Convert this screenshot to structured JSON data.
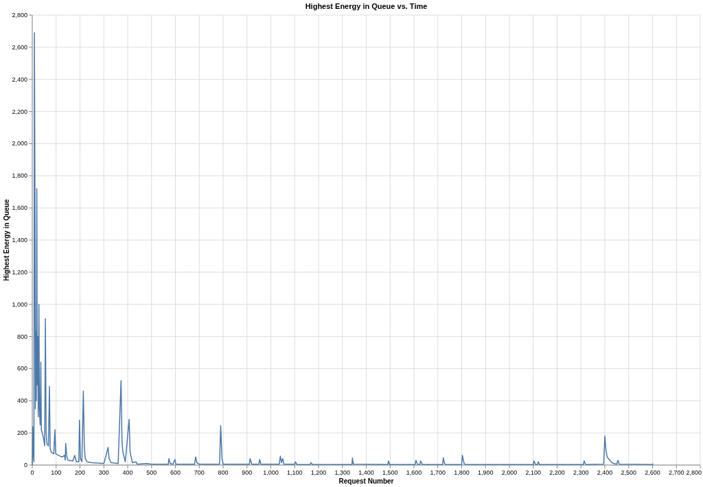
{
  "chart_data": {
    "type": "line",
    "title": "Highest Energy in Queue vs. Time",
    "xlabel": "Request Number",
    "ylabel": "Highest Energy in Queue",
    "xlim": [
      0,
      2800
    ],
    "ylim": [
      0,
      2800
    ],
    "xticks": [
      {
        "value": 0,
        "label": "0"
      },
      {
        "value": 100,
        "label": "100"
      },
      {
        "value": 200,
        "label": "200"
      },
      {
        "value": 300,
        "label": "300"
      },
      {
        "value": 400,
        "label": "400"
      },
      {
        "value": 500,
        "label": "500"
      },
      {
        "value": 600,
        "label": "600"
      },
      {
        "value": 700,
        "label": "700"
      },
      {
        "value": 800,
        "label": "800"
      },
      {
        "value": 900,
        "label": "900"
      },
      {
        "value": 1000,
        "label": "1,000"
      },
      {
        "value": 1100,
        "label": "1,100"
      },
      {
        "value": 1200,
        "label": "1,200"
      },
      {
        "value": 1300,
        "label": "1,300"
      },
      {
        "value": 1400,
        "label": "1,400"
      },
      {
        "value": 1500,
        "label": "1,500"
      },
      {
        "value": 1600,
        "label": "1,600"
      },
      {
        "value": 1700,
        "label": "1,700"
      },
      {
        "value": 1800,
        "label": "1,800"
      },
      {
        "value": 1900,
        "label": "1,900"
      },
      {
        "value": 2000,
        "label": "2,000"
      },
      {
        "value": 2100,
        "label": "2,100"
      },
      {
        "value": 2200,
        "label": "2,200"
      },
      {
        "value": 2300,
        "label": "2,300"
      },
      {
        "value": 2400,
        "label": "2,400"
      },
      {
        "value": 2500,
        "label": "2,500"
      },
      {
        "value": 2600,
        "label": "2,600"
      },
      {
        "value": 2700,
        "label": "2,700"
      },
      {
        "value": 2800,
        "label": "2,800"
      }
    ],
    "yticks": [
      {
        "value": 0,
        "label": "0"
      },
      {
        "value": 200,
        "label": "200"
      },
      {
        "value": 400,
        "label": "400"
      },
      {
        "value": 600,
        "label": "600"
      },
      {
        "value": 800,
        "label": "800"
      },
      {
        "value": 1000,
        "label": "1,000"
      },
      {
        "value": 1200,
        "label": "1,200"
      },
      {
        "value": 1400,
        "label": "1,400"
      },
      {
        "value": 1600,
        "label": "1,600"
      },
      {
        "value": 1800,
        "label": "1,800"
      },
      {
        "value": 2000,
        "label": "2,000"
      },
      {
        "value": 2200,
        "label": "2,200"
      },
      {
        "value": 2400,
        "label": "2,400"
      },
      {
        "value": 2600,
        "label": "2,600"
      },
      {
        "value": 2800,
        "label": "2,800"
      }
    ],
    "x": [
      0,
      2,
      5,
      7,
      9,
      11,
      13,
      15,
      17,
      19,
      21,
      23,
      25,
      28,
      30,
      33,
      36,
      38,
      42,
      48,
      52,
      55,
      58,
      62,
      68,
      72,
      75,
      80,
      90,
      95,
      98,
      110,
      125,
      135,
      138,
      140,
      145,
      150,
      170,
      178,
      185,
      195,
      198,
      202,
      208,
      214,
      218,
      222,
      230,
      250,
      300,
      318,
      322,
      330,
      360,
      372,
      376,
      380,
      390,
      406,
      410,
      420,
      435,
      440,
      480,
      500,
      570,
      573,
      578,
      590,
      598,
      602,
      680,
      685,
      690,
      700,
      785,
      790,
      795,
      800,
      910,
      913,
      920,
      950,
      953,
      958,
      1035,
      1040,
      1045,
      1050,
      1055,
      1100,
      1103,
      1110,
      1165,
      1168,
      1175,
      1340,
      1342,
      1346,
      1490,
      1493,
      1498,
      1605,
      1608,
      1615,
      1625,
      1628,
      1635,
      1720,
      1723,
      1728,
      1733,
      1800,
      1803,
      1810,
      1815,
      2100,
      2103,
      2110,
      2118,
      2121,
      2126,
      2310,
      2313,
      2320,
      2395,
      2400,
      2405,
      2410,
      2420,
      2430,
      2440,
      2450,
      2455,
      2460,
      2600,
      2602
    ],
    "grid": true,
    "values": [
      0,
      240,
      60,
      20,
      2690,
      1850,
      350,
      830,
      400,
      1720,
      500,
      800,
      300,
      1000,
      350,
      250,
      640,
      220,
      200,
      160,
      120,
      910,
      200,
      130,
      120,
      490,
      100,
      80,
      70,
      220,
      70,
      60,
      50,
      60,
      30,
      135,
      50,
      30,
      25,
      60,
      20,
      20,
      280,
      40,
      20,
      460,
      120,
      40,
      20,
      15,
      10,
      110,
      40,
      15,
      10,
      525,
      150,
      80,
      20,
      285,
      80,
      15,
      20,
      5,
      10,
      5,
      5,
      40,
      10,
      5,
      35,
      5,
      5,
      50,
      15,
      5,
      5,
      245,
      40,
      5,
      5,
      40,
      5,
      5,
      35,
      5,
      5,
      55,
      15,
      40,
      5,
      5,
      20,
      3,
      3,
      15,
      3,
      3,
      45,
      5,
      3,
      25,
      3,
      3,
      30,
      3,
      3,
      25,
      3,
      3,
      45,
      10,
      3,
      3,
      60,
      10,
      3,
      3,
      25,
      3,
      3,
      20,
      3,
      3,
      25,
      3,
      5,
      180,
      90,
      50,
      30,
      15,
      8,
      5,
      30,
      5,
      3,
      10
    ]
  }
}
